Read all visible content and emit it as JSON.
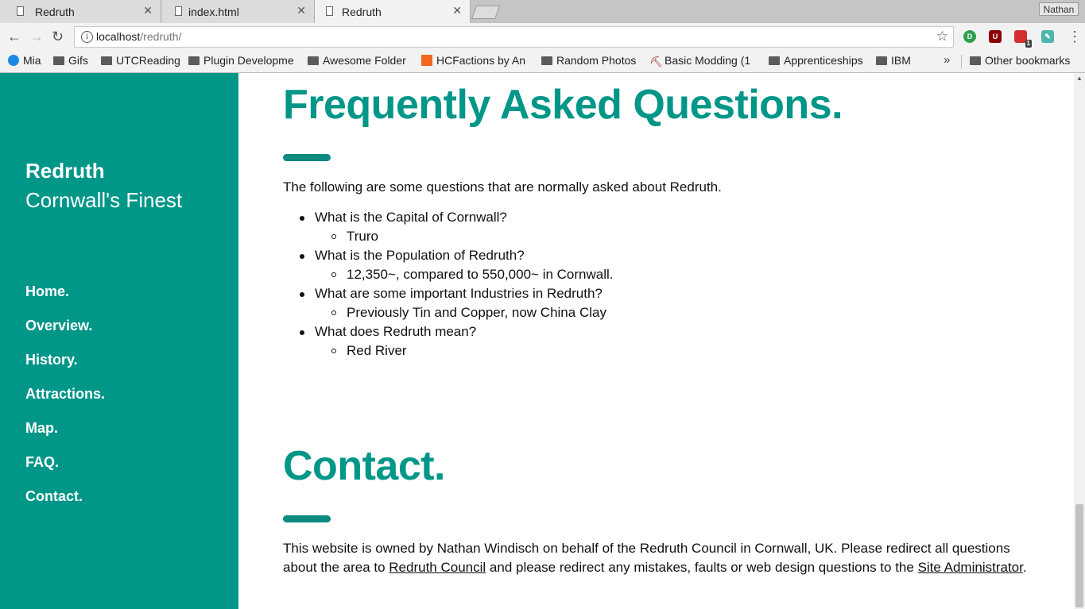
{
  "browser": {
    "tabs": [
      {
        "title": "Redruth"
      },
      {
        "title": "index.html"
      },
      {
        "title": "Redruth"
      }
    ],
    "profile_name": "Nathan",
    "url_host": "localhost",
    "url_path": "/redruth/",
    "bookmarks": [
      "Mia",
      "Gifs",
      "UTCReading",
      "Plugin Developme",
      "Awesome Folder",
      "HCFactions by An",
      "Random Photos",
      "Basic Modding (1",
      "Apprenticeships",
      "IBM"
    ],
    "other_bookmarks": "Other bookmarks",
    "overflow": "»",
    "ext_badge": "1"
  },
  "sidebar": {
    "title": "Redruth",
    "subtitle": "Cornwall's Finest",
    "nav": [
      "Home.",
      "Overview.",
      "History.",
      "Attractions.",
      "Map.",
      "FAQ.",
      "Contact."
    ]
  },
  "faq": {
    "heading": "Frequently Asked Questions.",
    "intro": "The following are some questions that are normally asked about Redruth.",
    "items": [
      {
        "q": "What is the Capital of Cornwall?",
        "a": "Truro"
      },
      {
        "q": "What is the Population of Redruth?",
        "a": "12,350~, compared to 550,000~ in Cornwall."
      },
      {
        "q": "What are some important Industries in Redruth?",
        "a": "Previously Tin and Copper, now China Clay"
      },
      {
        "q": "What does Redruth mean?",
        "a": "Red River"
      }
    ]
  },
  "contact": {
    "heading": "Contact.",
    "text_1": "This website is owned by Nathan Windisch on behalf of the Redruth Council in Cornwall, UK. Please redirect all questions about the area to ",
    "link_1": "Redruth Council",
    "text_2": " and please redirect any mistakes, faults or web design questions to the ",
    "link_2": "Site Administrator",
    "text_3": "."
  },
  "colors": {
    "accent": "#009688",
    "rule": "#0d8a80"
  }
}
